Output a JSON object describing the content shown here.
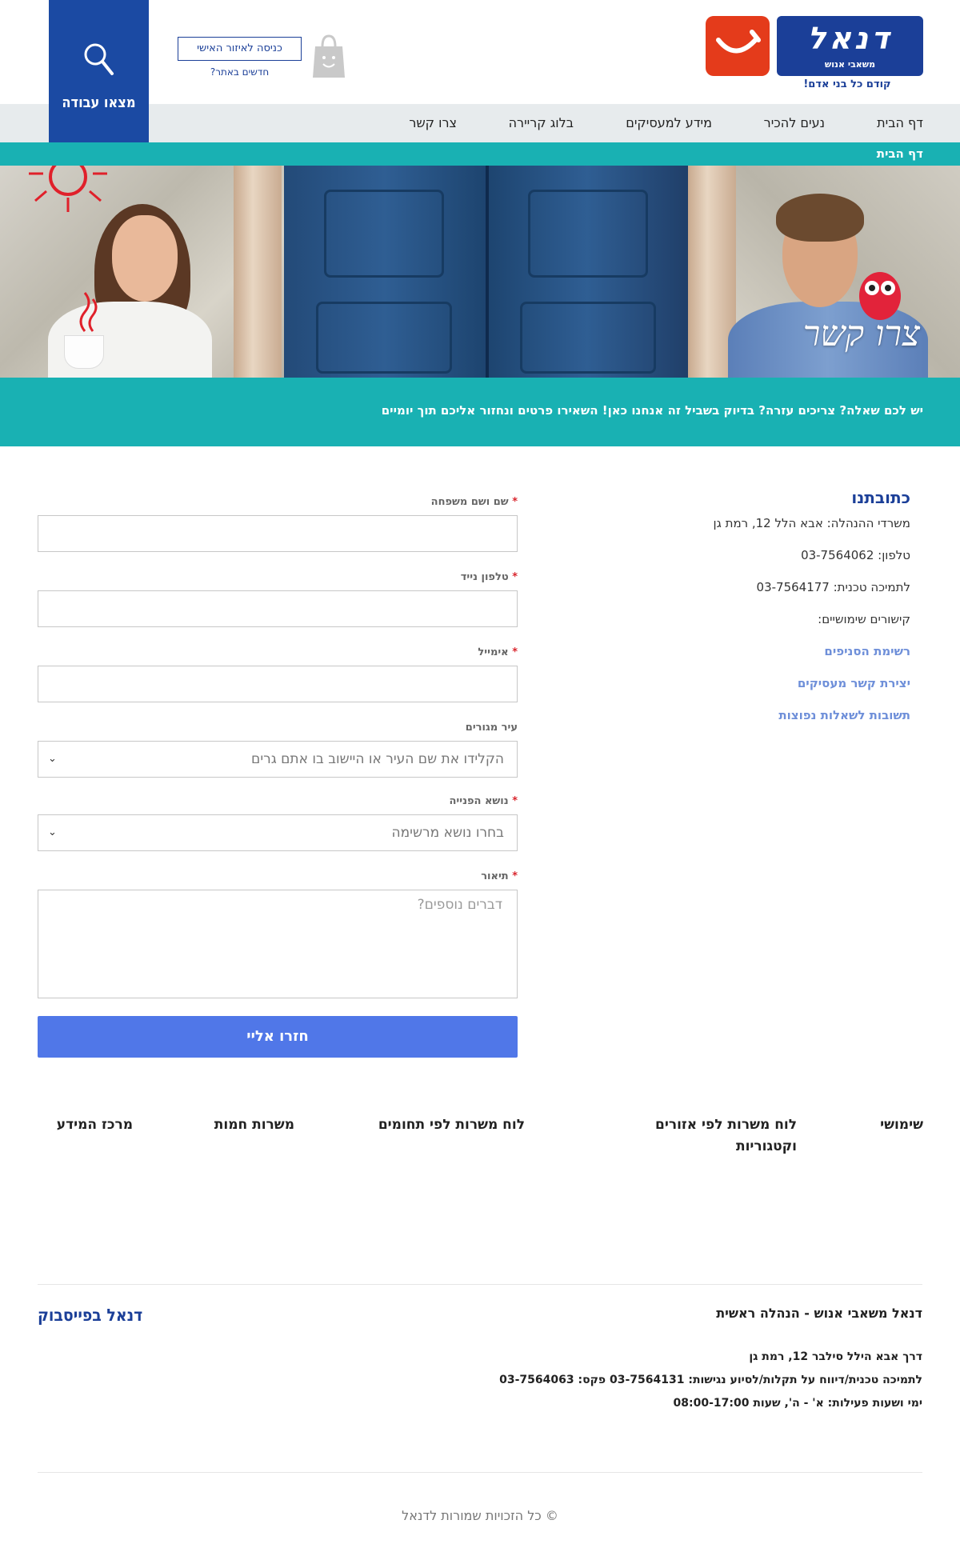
{
  "brand": {
    "logo_word": "דנאל",
    "logo_sub": "משאבי אנוש",
    "tagline": "קודם כל בני אדם!"
  },
  "header": {
    "personal_area": "כניסה לאיזור האישי",
    "whats_new": "חדשים באתר?",
    "find_job": "מצאו עבודה"
  },
  "nav": {
    "items": [
      "דף הבית",
      "נעים להכיר",
      "מידע למעסיקים",
      "בלוג קריירה",
      "צרו קשר"
    ]
  },
  "breadcrumb": "דף הבית",
  "hero": {
    "script": "צרו קשר"
  },
  "intro": "יש לכם שאלה? צריכים עזרה? בדיוק בשביל זה אנחנו כאן! השאירו פרטים ונחזור אליכם תוך יומיים",
  "address": {
    "title": "כתובתנו",
    "office": "משרדי ההנהלה: אבא הלל 12, רמת גן",
    "phone": "טלפון: 03-7564062",
    "support": "לתמיכה טכנית: 03-7564177",
    "useful": "קישורים שימושיים:",
    "links": [
      "רשימת הסניפים",
      "יצירת קשר מעסיקים",
      "תשובות לשאלות נפוצות"
    ]
  },
  "form": {
    "required_mark": "*",
    "name_label": "שם ושם משפחה",
    "phone_label": "טלפון נייד",
    "email_label": "אימייל",
    "city_label": "עיר מגורים",
    "city_placeholder": "הקלידו את שם העיר או היישוב בו אתם גרים",
    "topic_label": "נושא הפנייה",
    "topic_value": "בחרו נושא מרשימה",
    "desc_label": "תיאור",
    "desc_placeholder": "דברים נוספים?",
    "submit": "חזרו אליי"
  },
  "footer_links": [
    "שימושי",
    "לוח משרות לפי אזורים וקטגוריות",
    "לוח משרות לפי תחומים",
    "משרות חמות",
    "מרכז המידע"
  ],
  "footer": {
    "facebook": "דנאל בפייסבוק",
    "hq_title": "דנאל משאבי אנוש - הנהלה ראשית",
    "hq_address": "דרך אבא הילל סילבר 12, רמת גן",
    "hq_support": "לתמיכה טכנית/דיווח על תקלות/לסיוע נגישות: 03-7564131 פקס: 03-7564063",
    "hq_hours": "ימי ושעות פעילות: א' - ה', שעות 08:00-17:00",
    "copyright": "© כל הזכויות שמורות לדנאל"
  },
  "colors": {
    "brand_blue": "#1b3f98",
    "teal": "#19b1b3",
    "red": "#e43b1b",
    "button": "#5077e8",
    "link": "#6e8fd9"
  },
  "icons": [
    "search-icon",
    "shopping-bag-icon",
    "smile-logo-icon",
    "chevron-down-icon",
    "sun-icon",
    "owl-icon"
  ]
}
